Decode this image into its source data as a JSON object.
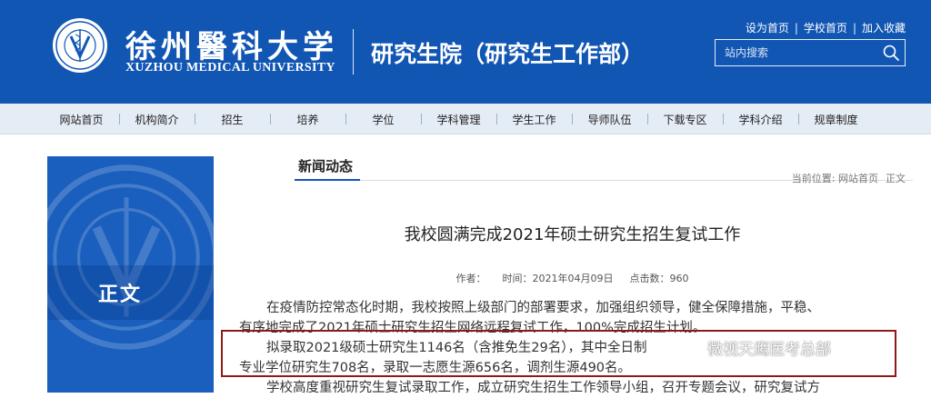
{
  "header": {
    "university_cn": "徐州醫科大学",
    "university_en": "XUZHOU MEDICAL UNIVERSITY",
    "department": "研究生院（研究生工作部）",
    "top_links": [
      "设为首页",
      "学校首页",
      "加入收藏"
    ],
    "search_placeholder": "站内搜索"
  },
  "nav": {
    "items": [
      "网站首页",
      "机构简介",
      "招生",
      "培养",
      "学位",
      "学科管理",
      "学生工作",
      "导师队伍",
      "下载专区",
      "学科介绍",
      "规章制度"
    ]
  },
  "sidebar": {
    "title": "正文"
  },
  "section": {
    "title": "新闻动态",
    "breadcrumb_label": "当前位置:",
    "breadcrumb_home": "网站首页",
    "breadcrumb_current": "正文"
  },
  "article": {
    "title": "我校圆满完成2021年硕士研究生招生复试工作",
    "author_label": "作者：",
    "time_label": "时间：",
    "time_value": "2021年04月09日",
    "clicks_label": "点击数：",
    "clicks_value": "960",
    "para1_line1": "在疫情防控常态化时期，我校按照上级部门的部署要求，加强组织领导，健全保障措施，平稳、",
    "para1_line2": "有序地完成了2021年硕士研究生招生网络远程复试工作，100%完成招生计划。",
    "para2_line1": "拟录取2021级硕士研究生1146名（含推免生29名），其中全日制",
    "para2_line2": "专业学位研究生708名，录取一志愿生源656名，调剂生源490名。",
    "para3_line1": "学校高度重视研究生复试录取工作，成立研究生招生工作领导小组，召开专题会议，研究复试方"
  },
  "watermark": {
    "text": "微视天鹰医考总部"
  },
  "colors": {
    "header_blue": "#1256b4",
    "nav_bg": "#e4ecf5",
    "highlight_border": "#8b1a1a"
  }
}
